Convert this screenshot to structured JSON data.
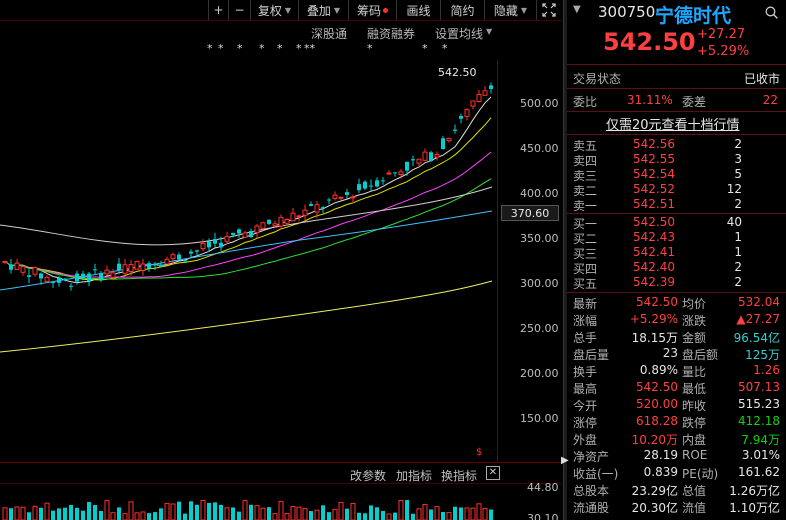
{
  "toolbar": {
    "plus": "+",
    "minus": "−",
    "fuquan": "复权",
    "diejia": "叠加",
    "chouma": "筹码",
    "huaxian": "画线",
    "jianyue": "简约",
    "yincang": "隐藏",
    "expand_icon": "expand-icon"
  },
  "chart_links": [
    "深股通",
    "融资融券",
    "设置均线"
  ],
  "y_ticks": [
    "500.00",
    "450.00",
    "400.00",
    "350.00",
    "300.00",
    "250.00",
    "200.00",
    "150.00"
  ],
  "y_highlight": "370.60",
  "price_label": "542.50",
  "subchart_toolbar": {
    "gaicanshu": "改参数",
    "jiazhibiao": "加指标",
    "huanzhibiao": "换指标",
    "close_icon": "close-icon"
  },
  "volume_ticks": [
    "44.80",
    "30.10"
  ],
  "colors": {
    "up": "#ff3030",
    "down": "#00d0d0",
    "ma5": "#e0e0e0",
    "ma10": "#e0e000",
    "ma20": "#ff40ff",
    "ma30": "#30e030",
    "ma60": "#d0d0d0",
    "ma120": "#40c0ff",
    "ma250": "#f0f060"
  },
  "stock": {
    "code": "300750",
    "name": "宁德时代",
    "price": "542.50",
    "change": "+27.27",
    "change_pct": "+5.29%",
    "status_label": "交易状态",
    "status_value": "已收市",
    "weibi_label": "委比",
    "weibi_value": "31.11%",
    "weicha_label": "委差",
    "weicha_value": "22",
    "promo": "仅需20元查看十档行情"
  },
  "order_book": {
    "sell": [
      {
        "label": "卖五",
        "price": "542.56",
        "vol": "2"
      },
      {
        "label": "卖四",
        "price": "542.55",
        "vol": "3"
      },
      {
        "label": "卖三",
        "price": "542.54",
        "vol": "5"
      },
      {
        "label": "卖二",
        "price": "542.52",
        "vol": "12"
      },
      {
        "label": "卖一",
        "price": "542.51",
        "vol": "2"
      }
    ],
    "buy": [
      {
        "label": "买一",
        "price": "542.50",
        "vol": "40"
      },
      {
        "label": "买二",
        "price": "542.43",
        "vol": "1"
      },
      {
        "label": "买三",
        "price": "542.41",
        "vol": "1"
      },
      {
        "label": "买四",
        "price": "542.40",
        "vol": "2"
      },
      {
        "label": "买五",
        "price": "542.39",
        "vol": "2"
      }
    ]
  },
  "stats": [
    {
      "l1": "最新",
      "v1": "542.50",
      "c1": "red",
      "l2": "均价",
      "v2": "532.04",
      "c2": "red"
    },
    {
      "l1": "涨幅",
      "v1": "+5.29%",
      "c1": "red",
      "l2": "涨跌",
      "v2": "▲27.27",
      "c2": "red"
    },
    {
      "l1": "总手",
      "v1": "18.15万",
      "c1": "wht",
      "l2": "金额",
      "v2": "96.54亿",
      "c2": "cyn"
    },
    {
      "l1": "盘后量",
      "v1": "23",
      "c1": "wht",
      "l2": "盘后额",
      "v2": "125万",
      "c2": "cyn"
    },
    {
      "l1": "换手",
      "v1": "0.89%",
      "c1": "wht",
      "l2": "量比",
      "v2": "1.26",
      "c2": "red"
    },
    {
      "l1": "最高",
      "v1": "542.50",
      "c1": "red",
      "l2": "最低",
      "v2": "507.13",
      "c2": "red"
    },
    {
      "l1": "今开",
      "v1": "520.00",
      "c1": "red",
      "l2": "昨收",
      "v2": "515.23",
      "c2": "wht"
    },
    {
      "l1": "涨停",
      "v1": "618.28",
      "c1": "red",
      "l2": "跌停",
      "v2": "412.18",
      "c2": "grn"
    },
    {
      "l1": "外盘",
      "v1": "10.20万",
      "c1": "red",
      "l2": "内盘",
      "v2": "7.94万",
      "c2": "grn"
    },
    {
      "l1": "净资产",
      "v1": "28.19",
      "c1": "wht",
      "l2": "ROE",
      "v2": "3.01%",
      "c2": "wht"
    },
    {
      "l1": "收益(一)",
      "v1": "0.839",
      "c1": "wht",
      "l2": "PE(动)",
      "v2": "161.62",
      "c2": "wht"
    },
    {
      "l1": "总股本",
      "v1": "23.29亿",
      "c1": "wht",
      "l2": "总值",
      "v2": "1.26万亿",
      "c2": "wht"
    },
    {
      "l1": "流通股",
      "v1": "20.30亿",
      "c1": "wht",
      "l2": "流值",
      "v2": "1.10万亿",
      "c2": "wht"
    }
  ]
}
